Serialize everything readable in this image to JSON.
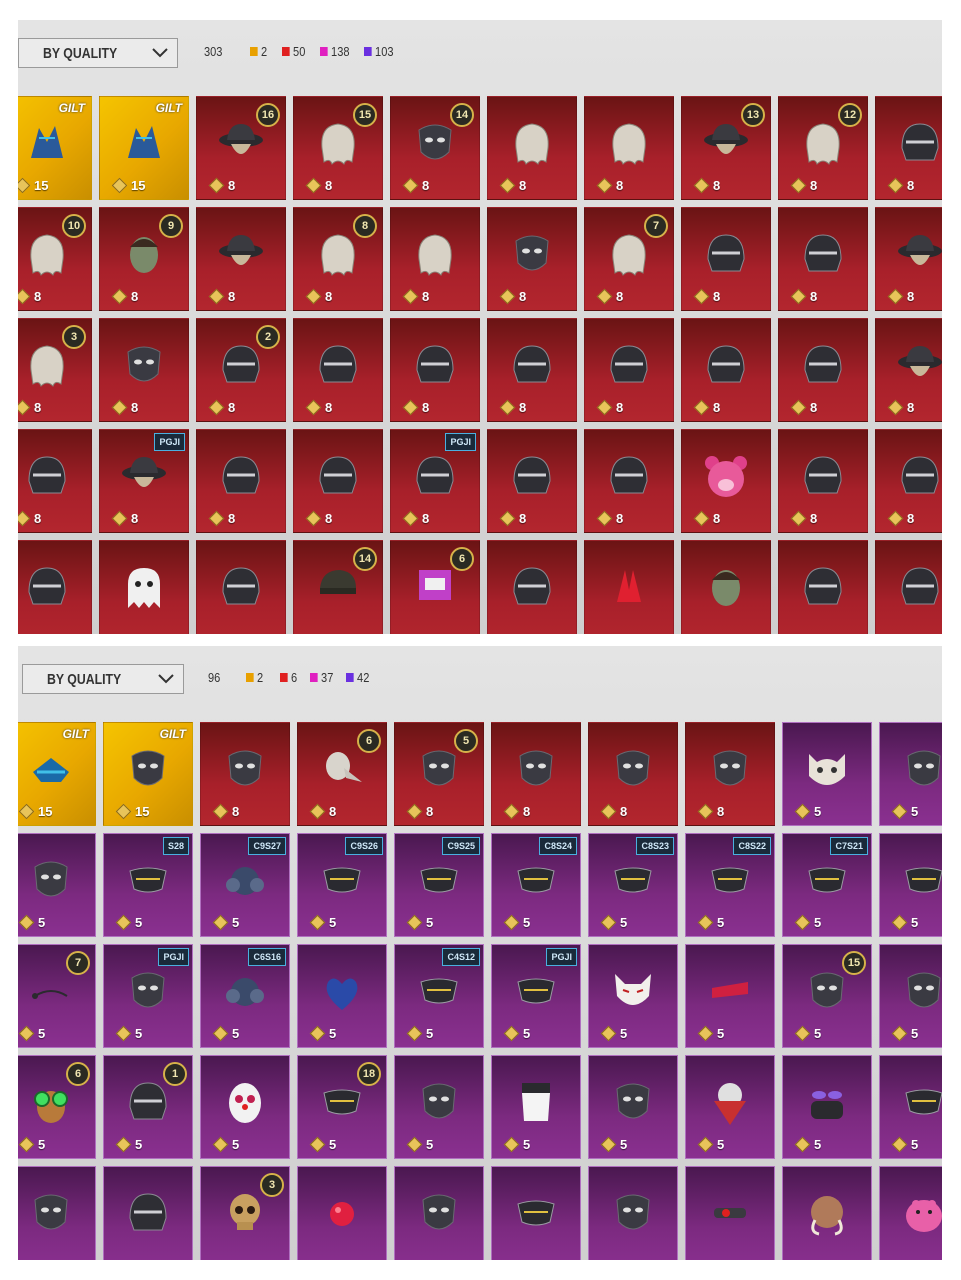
{
  "colors": {
    "legendary": "#e8a000",
    "epic": "#e02020",
    "mythic": "#e020c0",
    "rare": "#6a30e0"
  },
  "panels": [
    {
      "dropdown_label": "BY QUALITY",
      "total": "303",
      "counts": [
        "2",
        "50",
        "138",
        "103"
      ]
    },
    {
      "dropdown_label": "BY QUALITY",
      "total": "96",
      "counts": [
        "2",
        "6",
        "37",
        "42"
      ]
    }
  ],
  "grid1": [
    [
      {
        "type": "gold",
        "pts": "15",
        "badge": "GILT",
        "icon": "headgear-icon"
      },
      {
        "type": "gold",
        "pts": "15",
        "badge": "GILT",
        "icon": "headgear-icon"
      },
      {
        "type": "red",
        "pts": "8",
        "lvl": "16",
        "icon": "hat-icon"
      },
      {
        "type": "red",
        "pts": "8",
        "lvl": "15",
        "icon": "hair-icon"
      },
      {
        "type": "red",
        "pts": "8",
        "lvl": "14",
        "icon": "mask-icon"
      },
      {
        "type": "red",
        "pts": "8",
        "icon": "hair-icon"
      },
      {
        "type": "red",
        "pts": "8",
        "icon": "hair-icon"
      },
      {
        "type": "red",
        "pts": "8",
        "lvl": "13",
        "icon": "hat-icon"
      },
      {
        "type": "red",
        "pts": "8",
        "lvl": "12",
        "icon": "hair-icon"
      },
      {
        "type": "red",
        "pts": "8",
        "icon": "helmet-icon"
      }
    ],
    [
      {
        "type": "red",
        "pts": "8",
        "lvl": "10",
        "icon": "hair-icon"
      },
      {
        "type": "red",
        "pts": "8",
        "lvl": "9",
        "icon": "head-icon"
      },
      {
        "type": "red",
        "pts": "8",
        "icon": "hat-icon"
      },
      {
        "type": "red",
        "pts": "8",
        "lvl": "8",
        "icon": "hair-icon"
      },
      {
        "type": "red",
        "pts": "8",
        "icon": "hair-icon"
      },
      {
        "type": "red",
        "pts": "8",
        "icon": "mask-icon"
      },
      {
        "type": "red",
        "pts": "8",
        "lvl": "7",
        "icon": "hair-icon"
      },
      {
        "type": "red",
        "pts": "8",
        "icon": "helmet-icon"
      },
      {
        "type": "red",
        "pts": "8",
        "icon": "helmet-icon"
      },
      {
        "type": "red",
        "pts": "8",
        "icon": "hat-icon"
      }
    ],
    [
      {
        "type": "red",
        "pts": "8",
        "lvl": "3",
        "icon": "hair-icon"
      },
      {
        "type": "red",
        "pts": "8",
        "icon": "mask-icon"
      },
      {
        "type": "red",
        "pts": "8",
        "lvl": "2",
        "icon": "helmet-icon"
      },
      {
        "type": "red",
        "pts": "8",
        "icon": "helmet-icon"
      },
      {
        "type": "red",
        "pts": "8",
        "icon": "helmet-icon"
      },
      {
        "type": "red",
        "pts": "8",
        "icon": "helmet-icon"
      },
      {
        "type": "red",
        "pts": "8",
        "icon": "helmet-icon"
      },
      {
        "type": "red",
        "pts": "8",
        "icon": "helmet-icon"
      },
      {
        "type": "red",
        "pts": "8",
        "icon": "helmet-icon"
      },
      {
        "type": "red",
        "pts": "8",
        "icon": "hat-icon"
      }
    ],
    [
      {
        "type": "red",
        "pts": "8",
        "icon": "helmet-icon"
      },
      {
        "type": "red",
        "pts": "8",
        "badge": "PGJI",
        "icon": "hat-icon"
      },
      {
        "type": "red",
        "pts": "8",
        "icon": "helmet-icon"
      },
      {
        "type": "red",
        "pts": "8",
        "icon": "helmet-icon"
      },
      {
        "type": "red",
        "pts": "8",
        "badge": "PGJI",
        "icon": "helmet-icon"
      },
      {
        "type": "red",
        "pts": "8",
        "icon": "helmet-icon"
      },
      {
        "type": "red",
        "pts": "8",
        "icon": "helmet-icon"
      },
      {
        "type": "red",
        "pts": "8",
        "icon": "bear-head-icon"
      },
      {
        "type": "red",
        "pts": "8",
        "icon": "helmet-icon"
      },
      {
        "type": "red",
        "pts": "8",
        "icon": "helmet-icon"
      }
    ],
    [
      {
        "type": "red",
        "pts": "",
        "icon": "helmet-icon"
      },
      {
        "type": "red",
        "pts": "",
        "icon": "ghost-icon"
      },
      {
        "type": "red",
        "pts": "",
        "icon": "helmet-icon"
      },
      {
        "type": "red",
        "pts": "",
        "lvl": "14",
        "icon": "cap-icon"
      },
      {
        "type": "red",
        "pts": "",
        "lvl": "6",
        "icon": "box-head-icon"
      },
      {
        "type": "red",
        "pts": "",
        "icon": "helmet-icon"
      },
      {
        "type": "red",
        "pts": "",
        "icon": "horns-icon"
      },
      {
        "type": "red",
        "pts": "",
        "icon": "head-icon"
      },
      {
        "type": "red",
        "pts": "",
        "icon": "helmet-icon"
      },
      {
        "type": "red",
        "pts": "",
        "icon": "helmet-icon"
      }
    ]
  ],
  "grid2": [
    [
      {
        "type": "gold",
        "pts": "15",
        "badge": "GILT",
        "icon": "visor-icon"
      },
      {
        "type": "gold",
        "pts": "15",
        "badge": "GILT",
        "icon": "mask-icon"
      },
      {
        "type": "red",
        "pts": "8",
        "icon": "mask-icon"
      },
      {
        "type": "red",
        "pts": "8",
        "lvl": "6",
        "icon": "plague-mask-icon"
      },
      {
        "type": "red",
        "pts": "8",
        "lvl": "5",
        "icon": "mask-icon"
      },
      {
        "type": "red",
        "pts": "8",
        "icon": "mask-icon"
      },
      {
        "type": "red",
        "pts": "8",
        "icon": "mask-icon"
      },
      {
        "type": "red",
        "pts": "8",
        "icon": "mask-icon"
      },
      {
        "type": "purple",
        "pts": "5",
        "icon": "cat-mask-icon"
      },
      {
        "type": "purple",
        "pts": "5",
        "icon": "mask-icon"
      }
    ],
    [
      {
        "type": "purple",
        "pts": "5",
        "icon": "mask-icon"
      },
      {
        "type": "purple",
        "pts": "5",
        "badge": "S28",
        "icon": "face-mask-icon"
      },
      {
        "type": "purple",
        "pts": "5",
        "badge": "C9S27",
        "icon": "respirator-icon"
      },
      {
        "type": "purple",
        "pts": "5",
        "badge": "C9S26",
        "icon": "face-mask-icon"
      },
      {
        "type": "purple",
        "pts": "5",
        "badge": "C9S25",
        "icon": "face-mask-icon"
      },
      {
        "type": "purple",
        "pts": "5",
        "badge": "C8S24",
        "icon": "face-mask-icon"
      },
      {
        "type": "purple",
        "pts": "5",
        "badge": "C8S23",
        "icon": "face-mask-icon"
      },
      {
        "type": "purple",
        "pts": "5",
        "badge": "C8S22",
        "icon": "face-mask-icon"
      },
      {
        "type": "purple",
        "pts": "5",
        "badge": "C7S21",
        "icon": "face-mask-icon"
      },
      {
        "type": "purple",
        "pts": "5",
        "icon": "face-mask-icon"
      }
    ],
    [
      {
        "type": "purple",
        "pts": "5",
        "lvl": "7",
        "icon": "earpiece-icon"
      },
      {
        "type": "purple",
        "pts": "5",
        "badge": "PGJI",
        "icon": "mask-icon"
      },
      {
        "type": "purple",
        "pts": "5",
        "badge": "C6S16",
        "icon": "respirator-icon"
      },
      {
        "type": "purple",
        "pts": "5",
        "icon": "heart-mask-icon"
      },
      {
        "type": "purple",
        "pts": "5",
        "badge": "C4S12",
        "icon": "face-mask-icon"
      },
      {
        "type": "purple",
        "pts": "5",
        "badge": "PGJI",
        "icon": "face-mask-icon"
      },
      {
        "type": "purple",
        "pts": "5",
        "icon": "fox-mask-icon"
      },
      {
        "type": "purple",
        "pts": "5",
        "icon": "glasses-icon"
      },
      {
        "type": "purple",
        "pts": "5",
        "lvl": "15",
        "icon": "mask-icon"
      },
      {
        "type": "purple",
        "pts": "5",
        "icon": "mask-icon"
      }
    ],
    [
      {
        "type": "purple",
        "pts": "5",
        "lvl": "6",
        "icon": "goggles-icon"
      },
      {
        "type": "purple",
        "pts": "5",
        "lvl": "1",
        "icon": "helmet-icon"
      },
      {
        "type": "purple",
        "pts": "5",
        "icon": "clown-mask-icon"
      },
      {
        "type": "purple",
        "pts": "5",
        "lvl": "18",
        "icon": "face-mask-icon"
      },
      {
        "type": "purple",
        "pts": "5",
        "icon": "mask-icon"
      },
      {
        "type": "purple",
        "pts": "5",
        "icon": "veil-icon"
      },
      {
        "type": "purple",
        "pts": "5",
        "icon": "mask-icon"
      },
      {
        "type": "purple",
        "pts": "5",
        "icon": "bandana-icon"
      },
      {
        "type": "purple",
        "pts": "5",
        "icon": "sunglasses-icon"
      },
      {
        "type": "purple",
        "pts": "5",
        "icon": "face-mask-icon"
      }
    ],
    [
      {
        "type": "purple",
        "pts": "",
        "icon": "mask-icon"
      },
      {
        "type": "purple",
        "pts": "",
        "icon": "helmet-icon"
      },
      {
        "type": "purple",
        "pts": "",
        "lvl": "3",
        "icon": "skull-icon"
      },
      {
        "type": "purple",
        "pts": "",
        "icon": "nose-icon"
      },
      {
        "type": "purple",
        "pts": "",
        "icon": "mask-icon"
      },
      {
        "type": "purple",
        "pts": "",
        "icon": "face-mask-icon"
      },
      {
        "type": "purple",
        "pts": "",
        "icon": "mask-icon"
      },
      {
        "type": "purple",
        "pts": "",
        "icon": "gadget-icon"
      },
      {
        "type": "purple",
        "pts": "",
        "icon": "mammoth-icon"
      },
      {
        "type": "purple",
        "pts": "",
        "icon": "hippo-icon"
      }
    ]
  ]
}
